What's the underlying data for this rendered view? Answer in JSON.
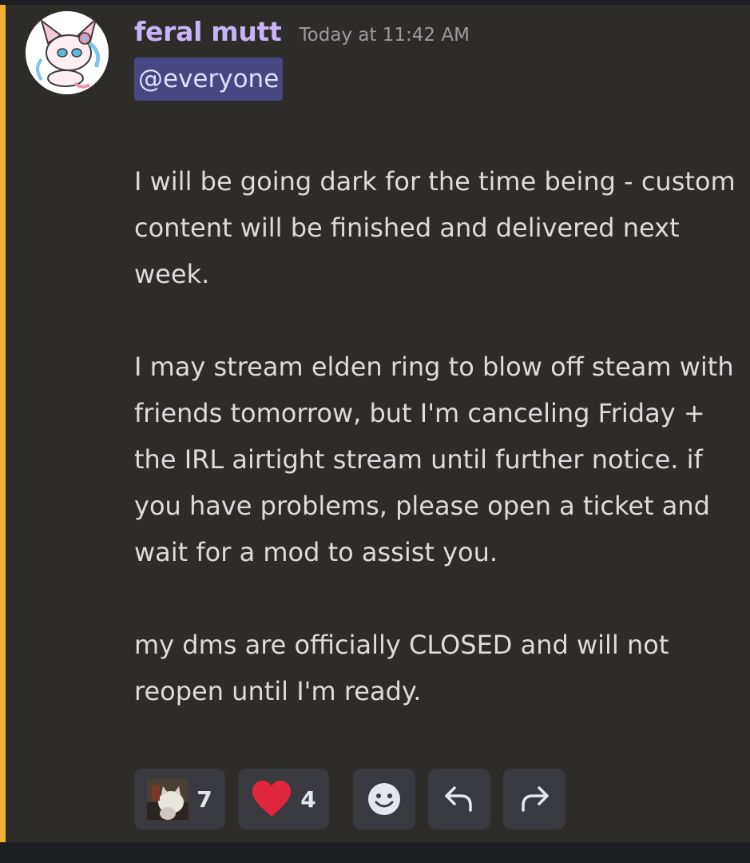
{
  "message": {
    "author": "feral mutt",
    "timestamp": "Today at 11:42 AM",
    "mention": "@everyone",
    "body": "I will be going dark for the time being - custom content will be finished and delivered next week.\n\nI may stream elden ring to blow off steam with friends tomorrow, but I'm canceling Friday + the IRL airtight stream until further notice. if you have problems, please open a ticket and wait for a mod to assist you.\n\nmy dms are officially CLOSED and will not reopen until I'm ready."
  },
  "reactions": [
    {
      "emoji": "cat-emoji",
      "count": "7"
    },
    {
      "emoji": "heart-emoji",
      "count": "4"
    }
  ],
  "actions": [
    "add-reaction-icon",
    "reply-icon",
    "forward-icon"
  ],
  "colors": {
    "username": "#c9b4f5",
    "mention_bar": "#f0b232",
    "mention_bg": "#474783",
    "heart": "#e0263a",
    "message_bg": "#2e2c29"
  }
}
